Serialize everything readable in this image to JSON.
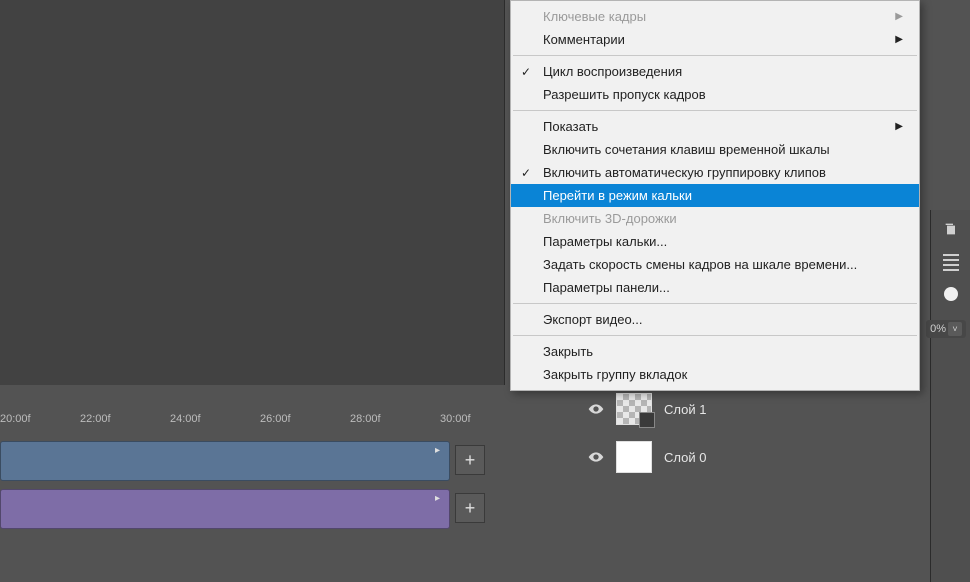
{
  "timeline": {
    "ticks": [
      "20:00f",
      "22:00f",
      "24:00f",
      "26:00f",
      "28:00f",
      "30:00f"
    ]
  },
  "layers": [
    {
      "label": "Слой 1",
      "thumb": "checker"
    },
    {
      "label": "Слой 0",
      "thumb": "white"
    }
  ],
  "percent": {
    "value": "0%"
  },
  "menu": {
    "items": [
      {
        "label": "Ключевые кадры",
        "disabled": true,
        "submenu": true
      },
      {
        "label": "Комментарии",
        "submenu": true
      },
      {
        "sep": true
      },
      {
        "label": "Цикл воспроизведения",
        "checked": true
      },
      {
        "label": "Разрешить пропуск кадров"
      },
      {
        "sep": true
      },
      {
        "label": "Показать",
        "submenu": true
      },
      {
        "label": "Включить сочетания клавиш временной шкалы"
      },
      {
        "label": "Включить автоматическую группировку клипов",
        "checked": true
      },
      {
        "label": "Перейти в режим кальки",
        "highlight": true
      },
      {
        "label": "Включить 3D-дорожки",
        "disabled": true
      },
      {
        "label": "Параметры кальки..."
      },
      {
        "label": "Задать скорость смены кадров на шкале времени..."
      },
      {
        "label": "Параметры панели..."
      },
      {
        "sep": true
      },
      {
        "label": "Экспорт видео..."
      },
      {
        "sep": true
      },
      {
        "label": "Закрыть"
      },
      {
        "label": "Закрыть группу вкладок"
      }
    ]
  }
}
